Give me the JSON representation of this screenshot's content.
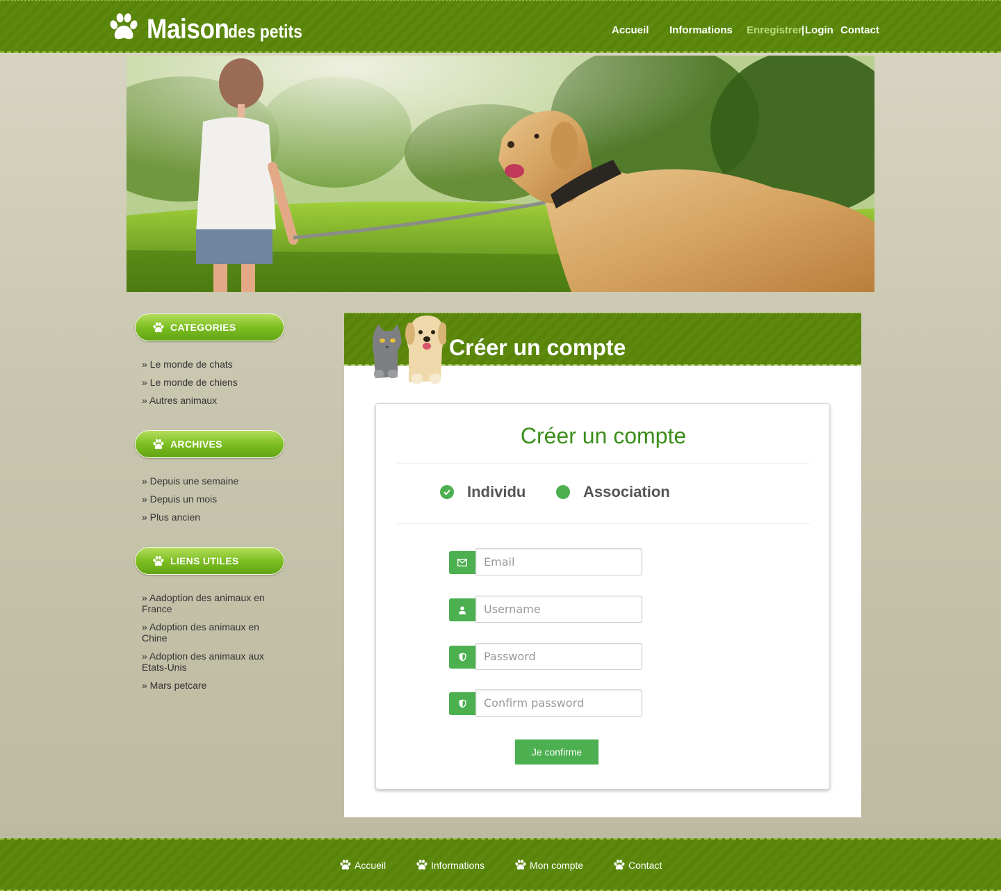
{
  "brand": {
    "name_big": "Maison",
    "name_small": "des petits"
  },
  "nav": {
    "accueil": "Accueil",
    "informations": "Informations",
    "enregistrer": "Enregistrer",
    "separator": "|",
    "login": "Login",
    "contact": "Contact"
  },
  "sidebar": {
    "categories": {
      "title": "CATEGORIES",
      "items": [
        "» Le monde de chats",
        "» Le monde de chiens",
        "» Autres animaux"
      ]
    },
    "archives": {
      "title": "ARCHIVES",
      "items": [
        "» Depuis une semaine",
        "» Depuis un mois",
        "» Plus ancien"
      ]
    },
    "liens": {
      "title": "LIENS UTILES",
      "items": [
        "» Aadoption des animaux en France",
        "» Adoption des animaux en Chine",
        "» Adoption des animaux aux Etats-Unis",
        "» Mars petcare"
      ]
    }
  },
  "main": {
    "header_title": "Créer un compte",
    "card_title": "Créer un compte",
    "account_types": {
      "individu": "Individu",
      "association": "Association"
    },
    "fields": {
      "email": {
        "placeholder": "Email",
        "icon": "envelope-icon"
      },
      "username": {
        "placeholder": "Username",
        "icon": "user-icon"
      },
      "password": {
        "placeholder": "Password",
        "icon": "shield-icon"
      },
      "confirm": {
        "placeholder": "Confirm password",
        "icon": "shield-icon"
      }
    },
    "submit_label": "Je confirme"
  },
  "footer": {
    "accueil": "Accueil",
    "informations": "Informations",
    "compte": "Mon compte",
    "contact": "Contact"
  },
  "colors": {
    "header_green": "#5d8a0e",
    "title_green": "#3b8e1a",
    "button_green": "#4caf50",
    "nav_active": "#b7de7c"
  }
}
